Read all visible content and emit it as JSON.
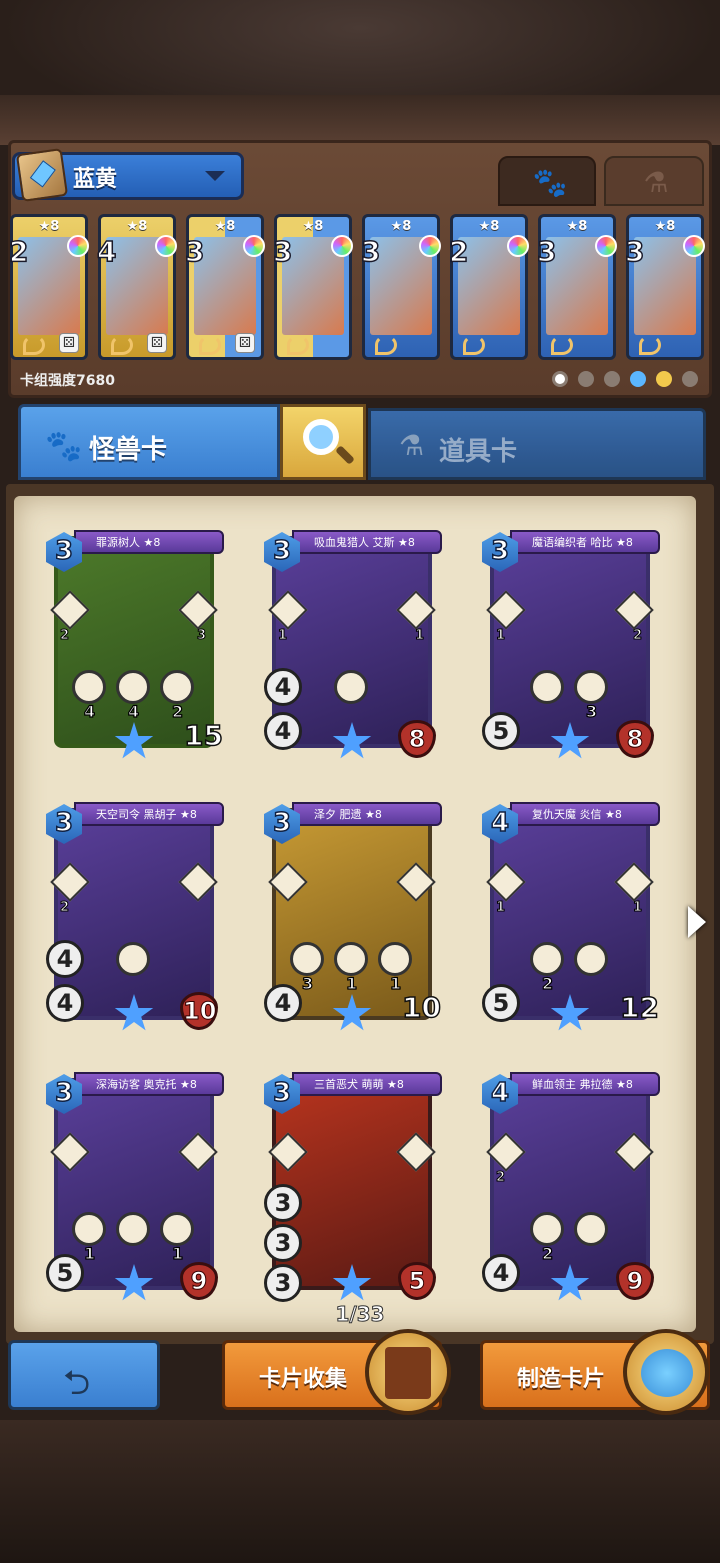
{
  "deck": {
    "name": "蓝黄",
    "power_label": "卡组强度7680"
  },
  "deck_cards": [
    {
      "cost": "2",
      "stars": "★8",
      "frame": "gold"
    },
    {
      "cost": "4",
      "stars": "★8",
      "frame": "gold"
    },
    {
      "cost": "3",
      "stars": "★8",
      "frame": "mix"
    },
    {
      "cost": "3",
      "stars": "★8",
      "frame": "mix"
    },
    {
      "cost": "3",
      "stars": "★8",
      "frame": "blue"
    },
    {
      "cost": "2",
      "stars": "★8",
      "frame": "blue"
    },
    {
      "cost": "3",
      "stars": "★8",
      "frame": "blue"
    },
    {
      "cost": "3",
      "stars": "★8",
      "frame": "blue"
    }
  ],
  "tabs": {
    "monster": "怪兽卡",
    "item": "道具卡"
  },
  "cards": [
    {
      "name": "罪源树人 ★8",
      "cost": "3",
      "left_ab": "2",
      "right_ab": "3",
      "orbs": [
        "4",
        "4",
        "2"
      ],
      "stat1": "",
      "stat2": "",
      "hp": "15",
      "theme": "green"
    },
    {
      "name": "吸血鬼猎人 艾斯 ★8",
      "cost": "3",
      "left_ab": "1",
      "right_ab": "1",
      "orbs": [
        ""
      ],
      "stat1": "4",
      "stat2": "4",
      "hp": "8",
      "theme": "purple"
    },
    {
      "name": "魔语编织者 哈比 ★8",
      "cost": "3",
      "left_ab": "1",
      "right_ab": "2",
      "orbs": [
        "",
        "3"
      ],
      "stat1": "",
      "stat2": "5",
      "hp": "8",
      "theme": "purple"
    },
    {
      "name": "天空司令 黑胡子 ★8",
      "cost": "3",
      "left_ab": "2",
      "right_ab": "",
      "orbs": [
        ""
      ],
      "stat1": "4",
      "stat2": "4",
      "hp": "10",
      "theme": "purple"
    },
    {
      "name": "泽夕 肥遗 ★8",
      "cost": "3",
      "left_ab": "",
      "right_ab": "",
      "orbs": [
        "3",
        "1",
        "1"
      ],
      "stat1": "",
      "stat2": "4",
      "hp": "10",
      "theme": "yellow"
    },
    {
      "name": "复仇天魔 炎信 ★8",
      "cost": "4",
      "left_ab": "1",
      "right_ab": "1",
      "orbs": [
        "2",
        ""
      ],
      "stat1": "",
      "stat2": "5",
      "hp": "12",
      "theme": "purple"
    },
    {
      "name": "深海访客 奥克托 ★8",
      "cost": "3",
      "left_ab": "",
      "right_ab": "",
      "orbs": [
        "1",
        "",
        "1"
      ],
      "stat1": "",
      "stat2": "5",
      "hp": "9",
      "theme": "purple"
    },
    {
      "name": "三首恶犬 萌萌 ★8",
      "cost": "3",
      "left_ab": "",
      "right_ab": "",
      "orbs": [],
      "stat1": "3",
      "stat2": "3",
      "stat3": "3",
      "hp": "5",
      "theme": "red"
    },
    {
      "name": "鲜血领主 弗拉德 ★8",
      "cost": "4",
      "left_ab": "2",
      "right_ab": "",
      "orbs": [
        "2",
        ""
      ],
      "stat1": "",
      "stat2": "4",
      "hp": "9",
      "theme": "purple"
    }
  ],
  "pagination": "1/33",
  "buttons": {
    "collect": "卡片收集",
    "craft": "制造卡片"
  }
}
